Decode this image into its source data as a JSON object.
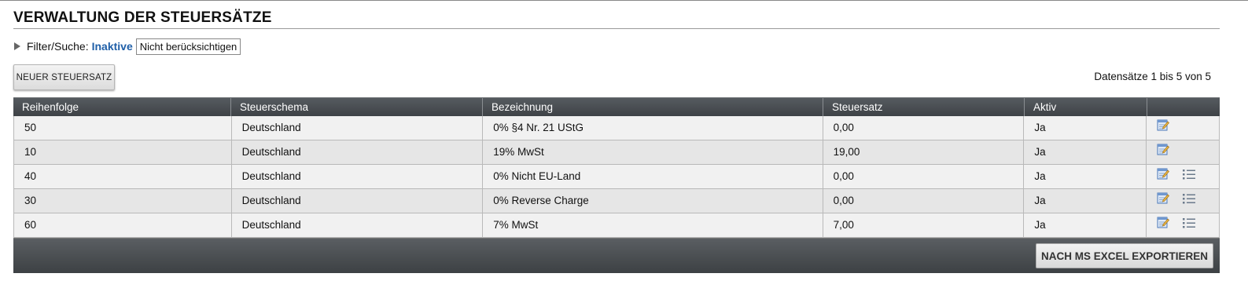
{
  "page": {
    "title": "VERWALTUNG DER STEUERSÄTZE"
  },
  "filter": {
    "label": "Filter/Suche:",
    "link": "Inaktive",
    "button": "Nicht berücksichtigen"
  },
  "toolbar": {
    "new_button": "NEUER STEUERSATZ",
    "records_info": "Datensätze 1 bis 5 von 5"
  },
  "table": {
    "columns": [
      "Reihenfolge",
      "Steuerschema",
      "Bezeichnung",
      "Steuersatz",
      "Aktiv",
      ""
    ],
    "rows": [
      {
        "order": "50",
        "scheme": "Deutschland",
        "name": "0% §4 Nr. 21 UStG",
        "rate": "0,00",
        "active": "Ja",
        "icons": [
          "edit-icon"
        ]
      },
      {
        "order": "10",
        "scheme": "Deutschland",
        "name": "19% MwSt",
        "rate": "19,00",
        "active": "Ja",
        "icons": [
          "edit-icon"
        ]
      },
      {
        "order": "40",
        "scheme": "Deutschland",
        "name": "0% Nicht EU-Land",
        "rate": "0,00",
        "active": "Ja",
        "icons": [
          "edit-icon",
          "list-icon"
        ]
      },
      {
        "order": "30",
        "scheme": "Deutschland",
        "name": "0% Reverse Charge",
        "rate": "0,00",
        "active": "Ja",
        "icons": [
          "edit-icon",
          "list-icon"
        ]
      },
      {
        "order": "60",
        "scheme": "Deutschland",
        "name": "7% MwSt",
        "rate": "7,00",
        "active": "Ja",
        "icons": [
          "edit-icon",
          "list-icon"
        ]
      }
    ]
  },
  "footer": {
    "export_button": "NACH MS EXCEL EXPORTIEREN"
  },
  "colors": {
    "header_bg": "#4a4e52",
    "link": "#1f5fa8",
    "row_odd": "#f1f1f1",
    "row_even": "#e6e6e6"
  }
}
